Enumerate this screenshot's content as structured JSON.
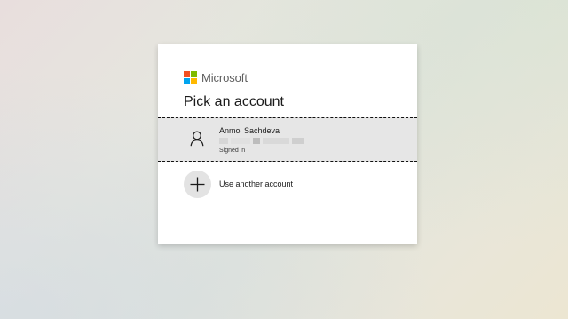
{
  "brand": {
    "name": "Microsoft",
    "logo_colors": [
      "#f25022",
      "#7fba00",
      "#00a4ef",
      "#ffb900"
    ]
  },
  "dialog": {
    "title": "Pick an account"
  },
  "accounts": [
    {
      "name": "Anmol Sachdeva",
      "status": "Signed in",
      "icon": "person-icon"
    }
  ],
  "add_account": {
    "label": "Use another account",
    "icon": "plus-icon"
  }
}
